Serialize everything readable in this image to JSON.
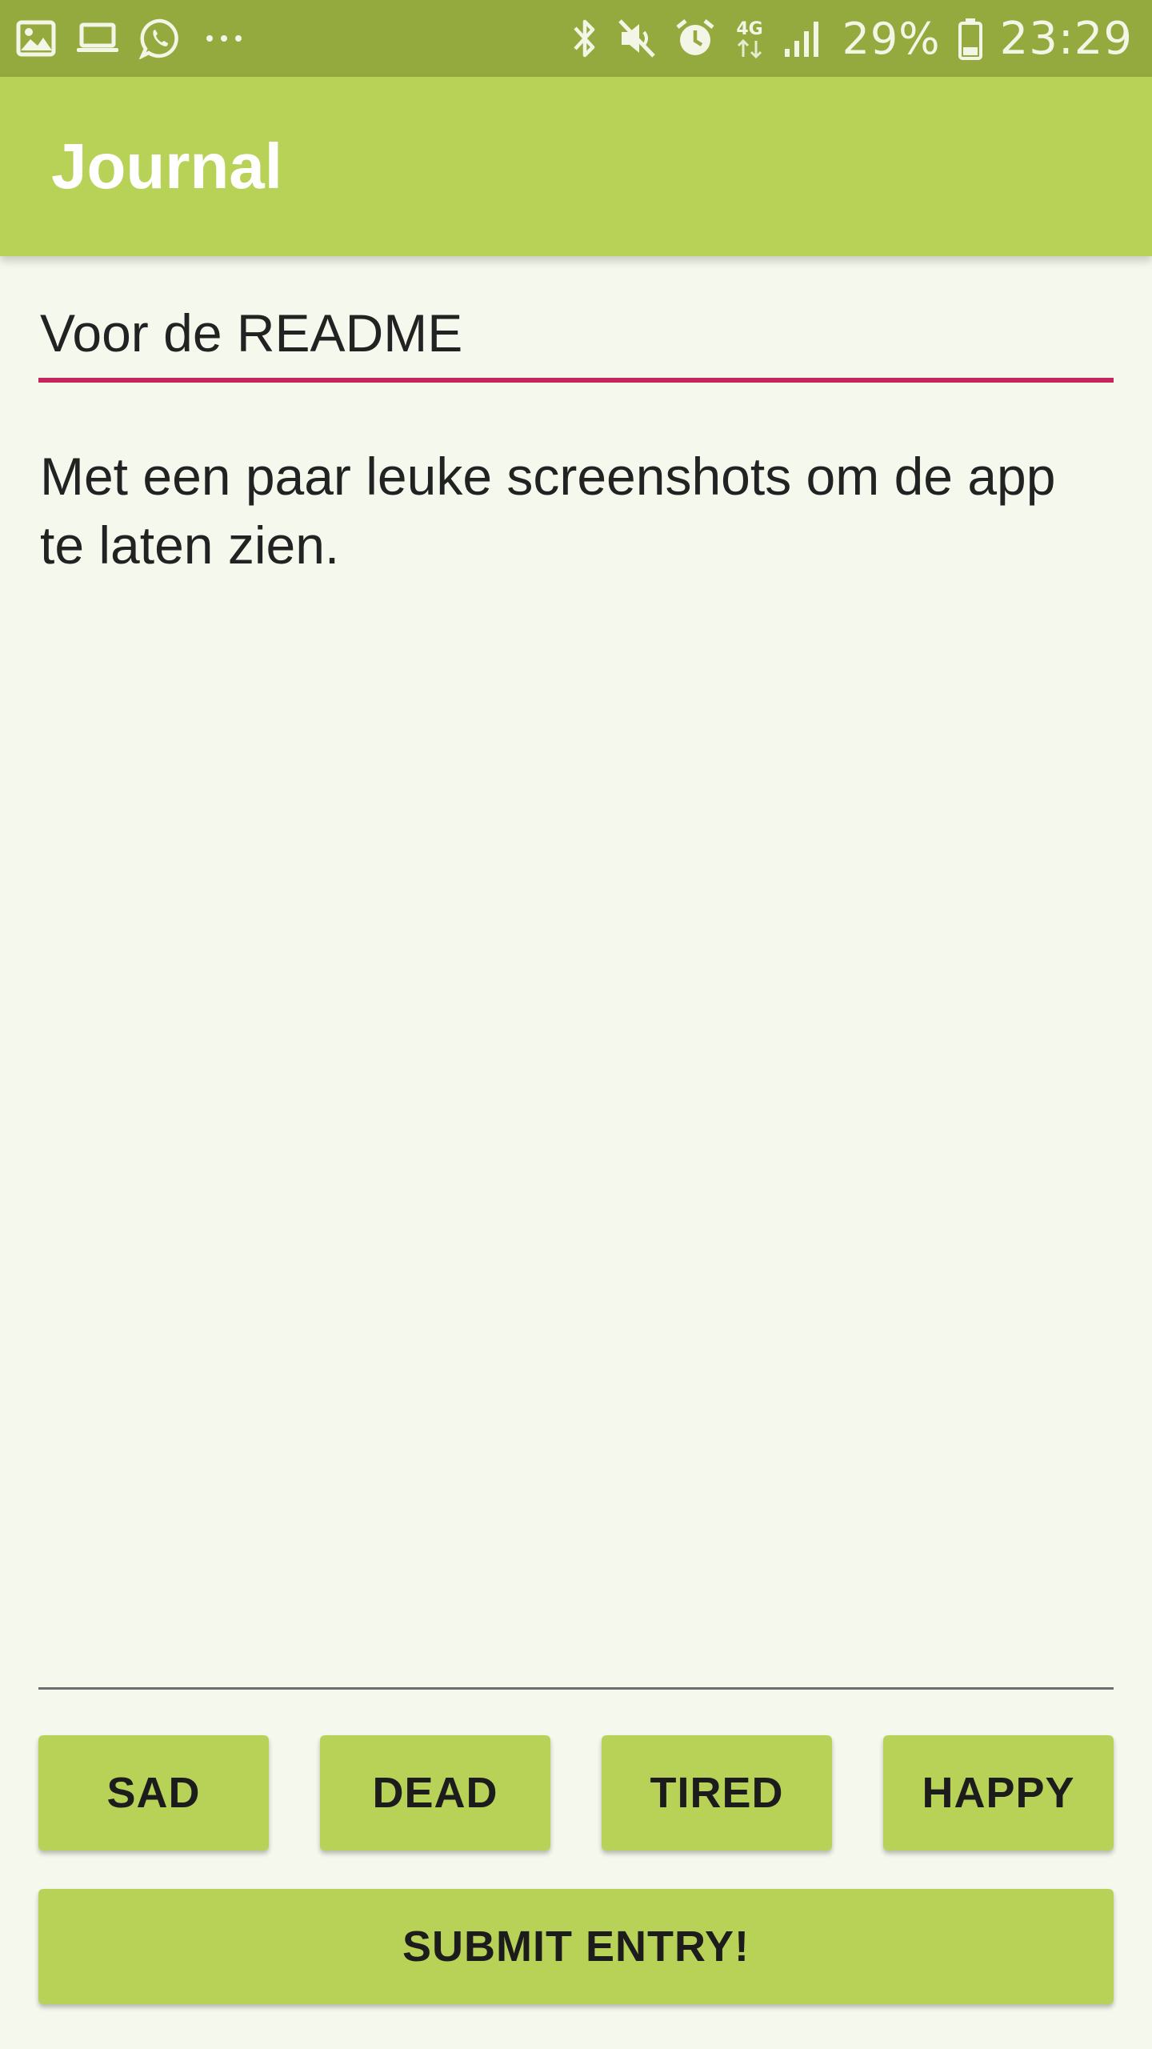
{
  "status_bar": {
    "left_icons": [
      "image-icon",
      "laptop-icon",
      "whatsapp-icon",
      "more-dots-icon"
    ],
    "right_icons": [
      "bluetooth-icon",
      "mute-icon",
      "alarm-icon",
      "network-4g-icon",
      "signal-icon",
      "battery-icon"
    ],
    "network_label": "4G",
    "battery_percent": "29%",
    "time": "23:29"
  },
  "app_bar": {
    "title": "Journal"
  },
  "entry": {
    "title_value": "Voor de README",
    "body_value": "Met een paar leuke screenshots om de app te laten zien."
  },
  "moods": [
    "SAD",
    "DEAD",
    "TIRED",
    "HAPPY"
  ],
  "submit_label": "SUBMIT ENTRY!",
  "colors": {
    "status_bar": "#94aa3e",
    "primary": "#b7d257",
    "accent": "#c4255a",
    "background": "#f5f8ec"
  }
}
